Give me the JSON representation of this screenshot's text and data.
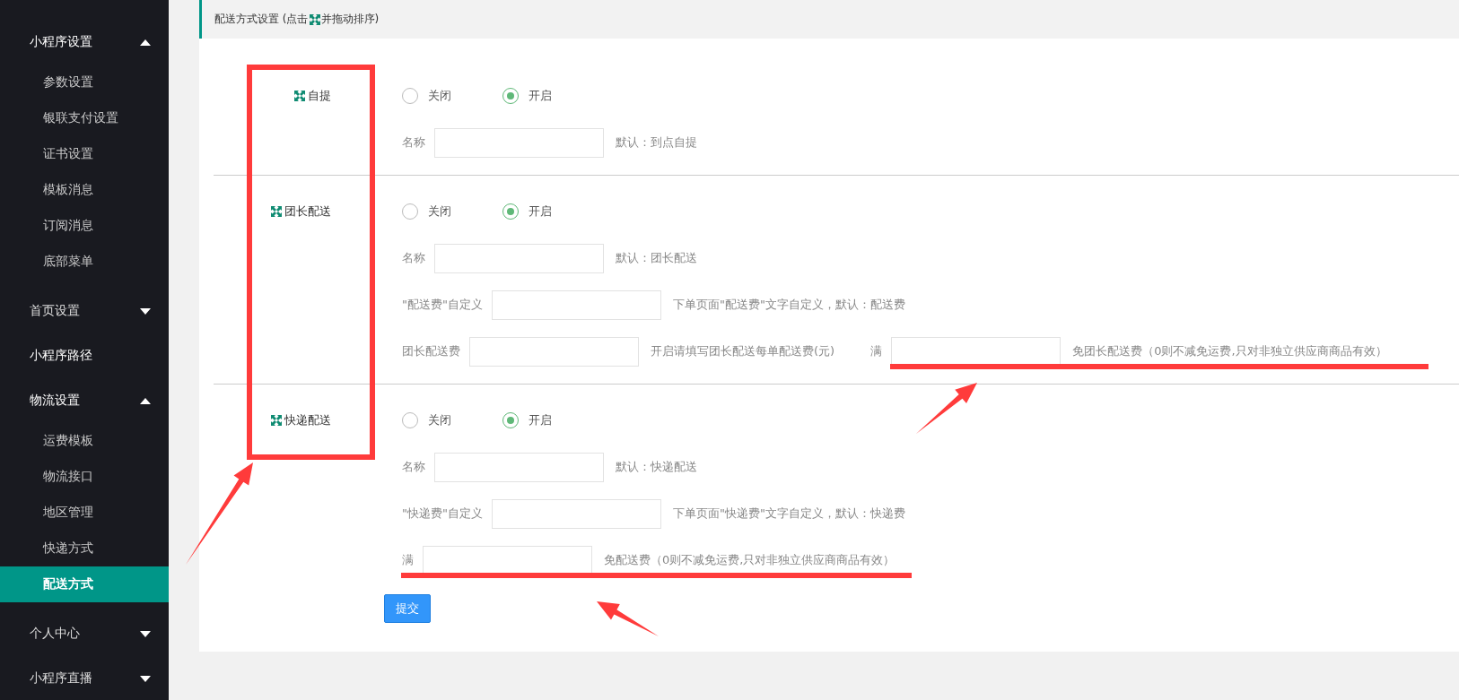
{
  "sidebar": {
    "items": [
      {
        "label": "小程序设置",
        "expanded": true,
        "children": [
          {
            "label": "参数设置",
            "selected": false
          },
          {
            "label": "银联支付设置",
            "selected": false
          },
          {
            "label": "证书设置",
            "selected": false
          },
          {
            "label": "模板消息",
            "selected": false
          },
          {
            "label": "订阅消息",
            "selected": false
          },
          {
            "label": "底部菜单",
            "selected": false
          }
        ]
      },
      {
        "label": "首页设置",
        "expanded": false
      },
      {
        "label": "小程序路径"
      },
      {
        "label": "物流设置",
        "expanded": true,
        "children": [
          {
            "label": "运费模板",
            "selected": false
          },
          {
            "label": "物流接口",
            "selected": false
          },
          {
            "label": "地区管理",
            "selected": false
          },
          {
            "label": "快递方式",
            "selected": false
          },
          {
            "label": "配送方式",
            "selected": true
          }
        ]
      },
      {
        "label": "个人中心",
        "expanded": false
      },
      {
        "label": "小程序直播",
        "expanded": false
      }
    ]
  },
  "panel": {
    "title_parts": [
      "配送方式设置 (点击",
      "并拖动排序)"
    ],
    "sections": [
      {
        "label": "自提",
        "options": [
          {
            "label": "关闭",
            "selected": false
          },
          {
            "label": "开启",
            "selected": true
          }
        ],
        "rows": [
          [
            {
              "label": "名称",
              "hint": "默认：到点自提"
            }
          ]
        ]
      },
      {
        "label": "团长配送",
        "options": [
          {
            "label": "关闭",
            "selected": false
          },
          {
            "label": "开启",
            "selected": true
          }
        ],
        "rows": [
          [
            {
              "label": "名称",
              "hint": "默认：团长配送"
            }
          ],
          [
            {
              "label": "\"配送费\"自定义",
              "hint": "下单页面\"配送费\"文字自定义，默认：配送费"
            }
          ],
          [
            {
              "label": "团长配送费",
              "hint": "开启请填写团长配送每单配送费(元)"
            },
            {
              "label": "满",
              "hint": "免团长配送费（0则不减免运费,只对非独立供应商商品有效）"
            }
          ]
        ]
      },
      {
        "label": "快递配送",
        "options": [
          {
            "label": "关闭",
            "selected": false
          },
          {
            "label": "开启",
            "selected": true
          }
        ],
        "rows": [
          [
            {
              "label": "名称",
              "hint": "默认：快递配送"
            }
          ],
          [
            {
              "label": "\"快递费\"自定义",
              "hint": "下单页面\"快递费\"文字自定义，默认：快递费"
            }
          ],
          [
            {
              "label": "满",
              "hint": "免配送费（0则不减免运费,只对非独立供应商商品有效）"
            }
          ]
        ]
      }
    ],
    "submit": "提交"
  }
}
